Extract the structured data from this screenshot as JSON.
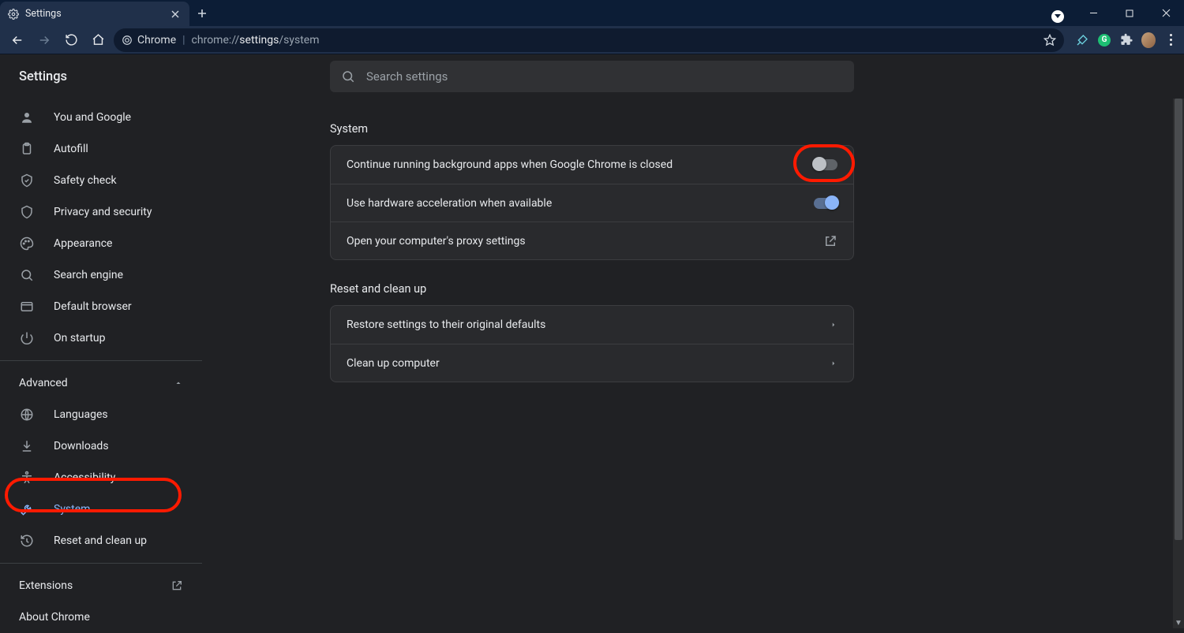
{
  "window": {
    "tab_title": "Settings"
  },
  "omnibox": {
    "chip": "Chrome",
    "url_prefix": "chrome://",
    "url_mid": "settings",
    "url_suffix": "/system"
  },
  "header": {
    "title": "Settings"
  },
  "search": {
    "placeholder": "Search settings"
  },
  "sidebar": {
    "items": [
      {
        "label": "You and Google"
      },
      {
        "label": "Autofill"
      },
      {
        "label": "Safety check"
      },
      {
        "label": "Privacy and security"
      },
      {
        "label": "Appearance"
      },
      {
        "label": "Search engine"
      },
      {
        "label": "Default browser"
      },
      {
        "label": "On startup"
      }
    ],
    "advanced_label": "Advanced",
    "advanced_items": [
      {
        "label": "Languages"
      },
      {
        "label": "Downloads"
      },
      {
        "label": "Accessibility"
      },
      {
        "label": "System"
      },
      {
        "label": "Reset and clean up"
      }
    ],
    "extensions_label": "Extensions",
    "about_label": "About Chrome"
  },
  "sections": {
    "system": {
      "title": "System",
      "rows": [
        {
          "label": "Continue running background apps when Google Chrome is closed",
          "toggle": "off"
        },
        {
          "label": "Use hardware acceleration when available",
          "toggle": "on"
        },
        {
          "label": "Open your computer's proxy settings",
          "action": "external"
        }
      ]
    },
    "reset": {
      "title": "Reset and clean up",
      "rows": [
        {
          "label": "Restore settings to their original defaults",
          "action": "chevron"
        },
        {
          "label": "Clean up computer",
          "action": "chevron"
        }
      ]
    }
  }
}
